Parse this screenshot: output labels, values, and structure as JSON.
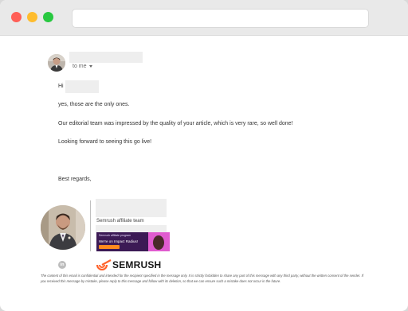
{
  "email": {
    "recipient_label": "to me",
    "greeting": "Hi",
    "body_lines": [
      "yes, those are the only ones.",
      "Our editorial team was impressed by the quality of your article, which is very rare, so well done!",
      "Looking forward to seeing this go live!"
    ],
    "closing": "Best regards,"
  },
  "signature": {
    "team": "Semrush affiliate team",
    "banner_small": "Semrush affiliate program",
    "banner_headline": "We're on Impact Radius!",
    "linkedin_glyph": "in",
    "brand_word": "SEMRUSH",
    "brand_color": "#ff642d"
  },
  "disclaimer": "The content of this email is confidential and intended for the recipient specified in the message only. It is strictly forbidden to share any part of this message with any third party, without the written consent of the sender. If you received this message by mistake, please reply to this message and follow with its deletion, so that we can ensure such a mistake does not occur in the future."
}
